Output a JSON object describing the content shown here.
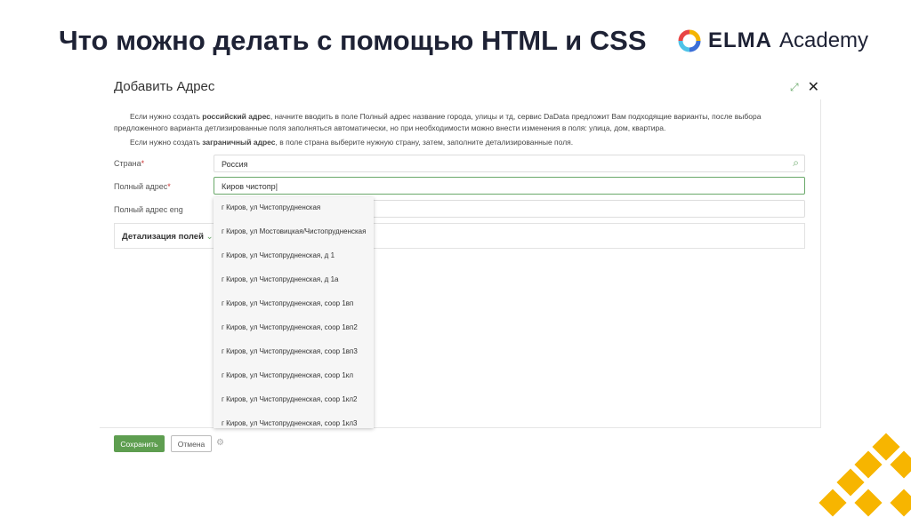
{
  "slide": {
    "title": "Что можно делать с помощью HTML и CSS",
    "logo_name": "ELMA",
    "logo_sub": "Academy"
  },
  "dialog": {
    "title": "Добавить Адрес",
    "info1_pre": "Если нужно создать ",
    "info1_bold": "российский адрес",
    "info1_post": ", начните вводить в поле Полный адрес название города, улицы и тд, сервис DaData предложит Вам подходящие варианты, после выбора  предложенного варианта детлизированные поля заполняться автоматически, но при необходимости можно внести изменения в поля: улица, дом, квартира.",
    "info2_pre": "Если нужно создать ",
    "info2_bold": "заграничный адрес",
    "info2_post": ", в поле страна выберите нужную страну, затем, заполните детализированные поля.",
    "country_label": "Страна",
    "country_value": "Россия",
    "address_label": "Полный адрес",
    "address_value": "Киров чистопр",
    "address_eng_label": "Полный адрес eng",
    "required_mark": "*",
    "details_label": "Детализация полей",
    "suggestions": [
      "г Киров, ул Чистопрудненская",
      "г Киров, ул Мостовицкая/Чистопрудненская",
      "г Киров, ул Чистопрудненская, д 1",
      "г Киров, ул Чистопрудненская, д 1а",
      "г Киров, ул Чистопрудненская, соор 1вп",
      "г Киров, ул Чистопрудненская, соор 1вп2",
      "г Киров, ул Чистопрудненская, соор 1вп3",
      "г Киров, ул Чистопрудненская, соор 1кл",
      "г Киров, ул Чистопрудненская, соор 1кл2",
      "г Киров, ул Чистопрудненская, соор 1кл3"
    ],
    "save": "Сохранить",
    "cancel": "Отмена"
  }
}
